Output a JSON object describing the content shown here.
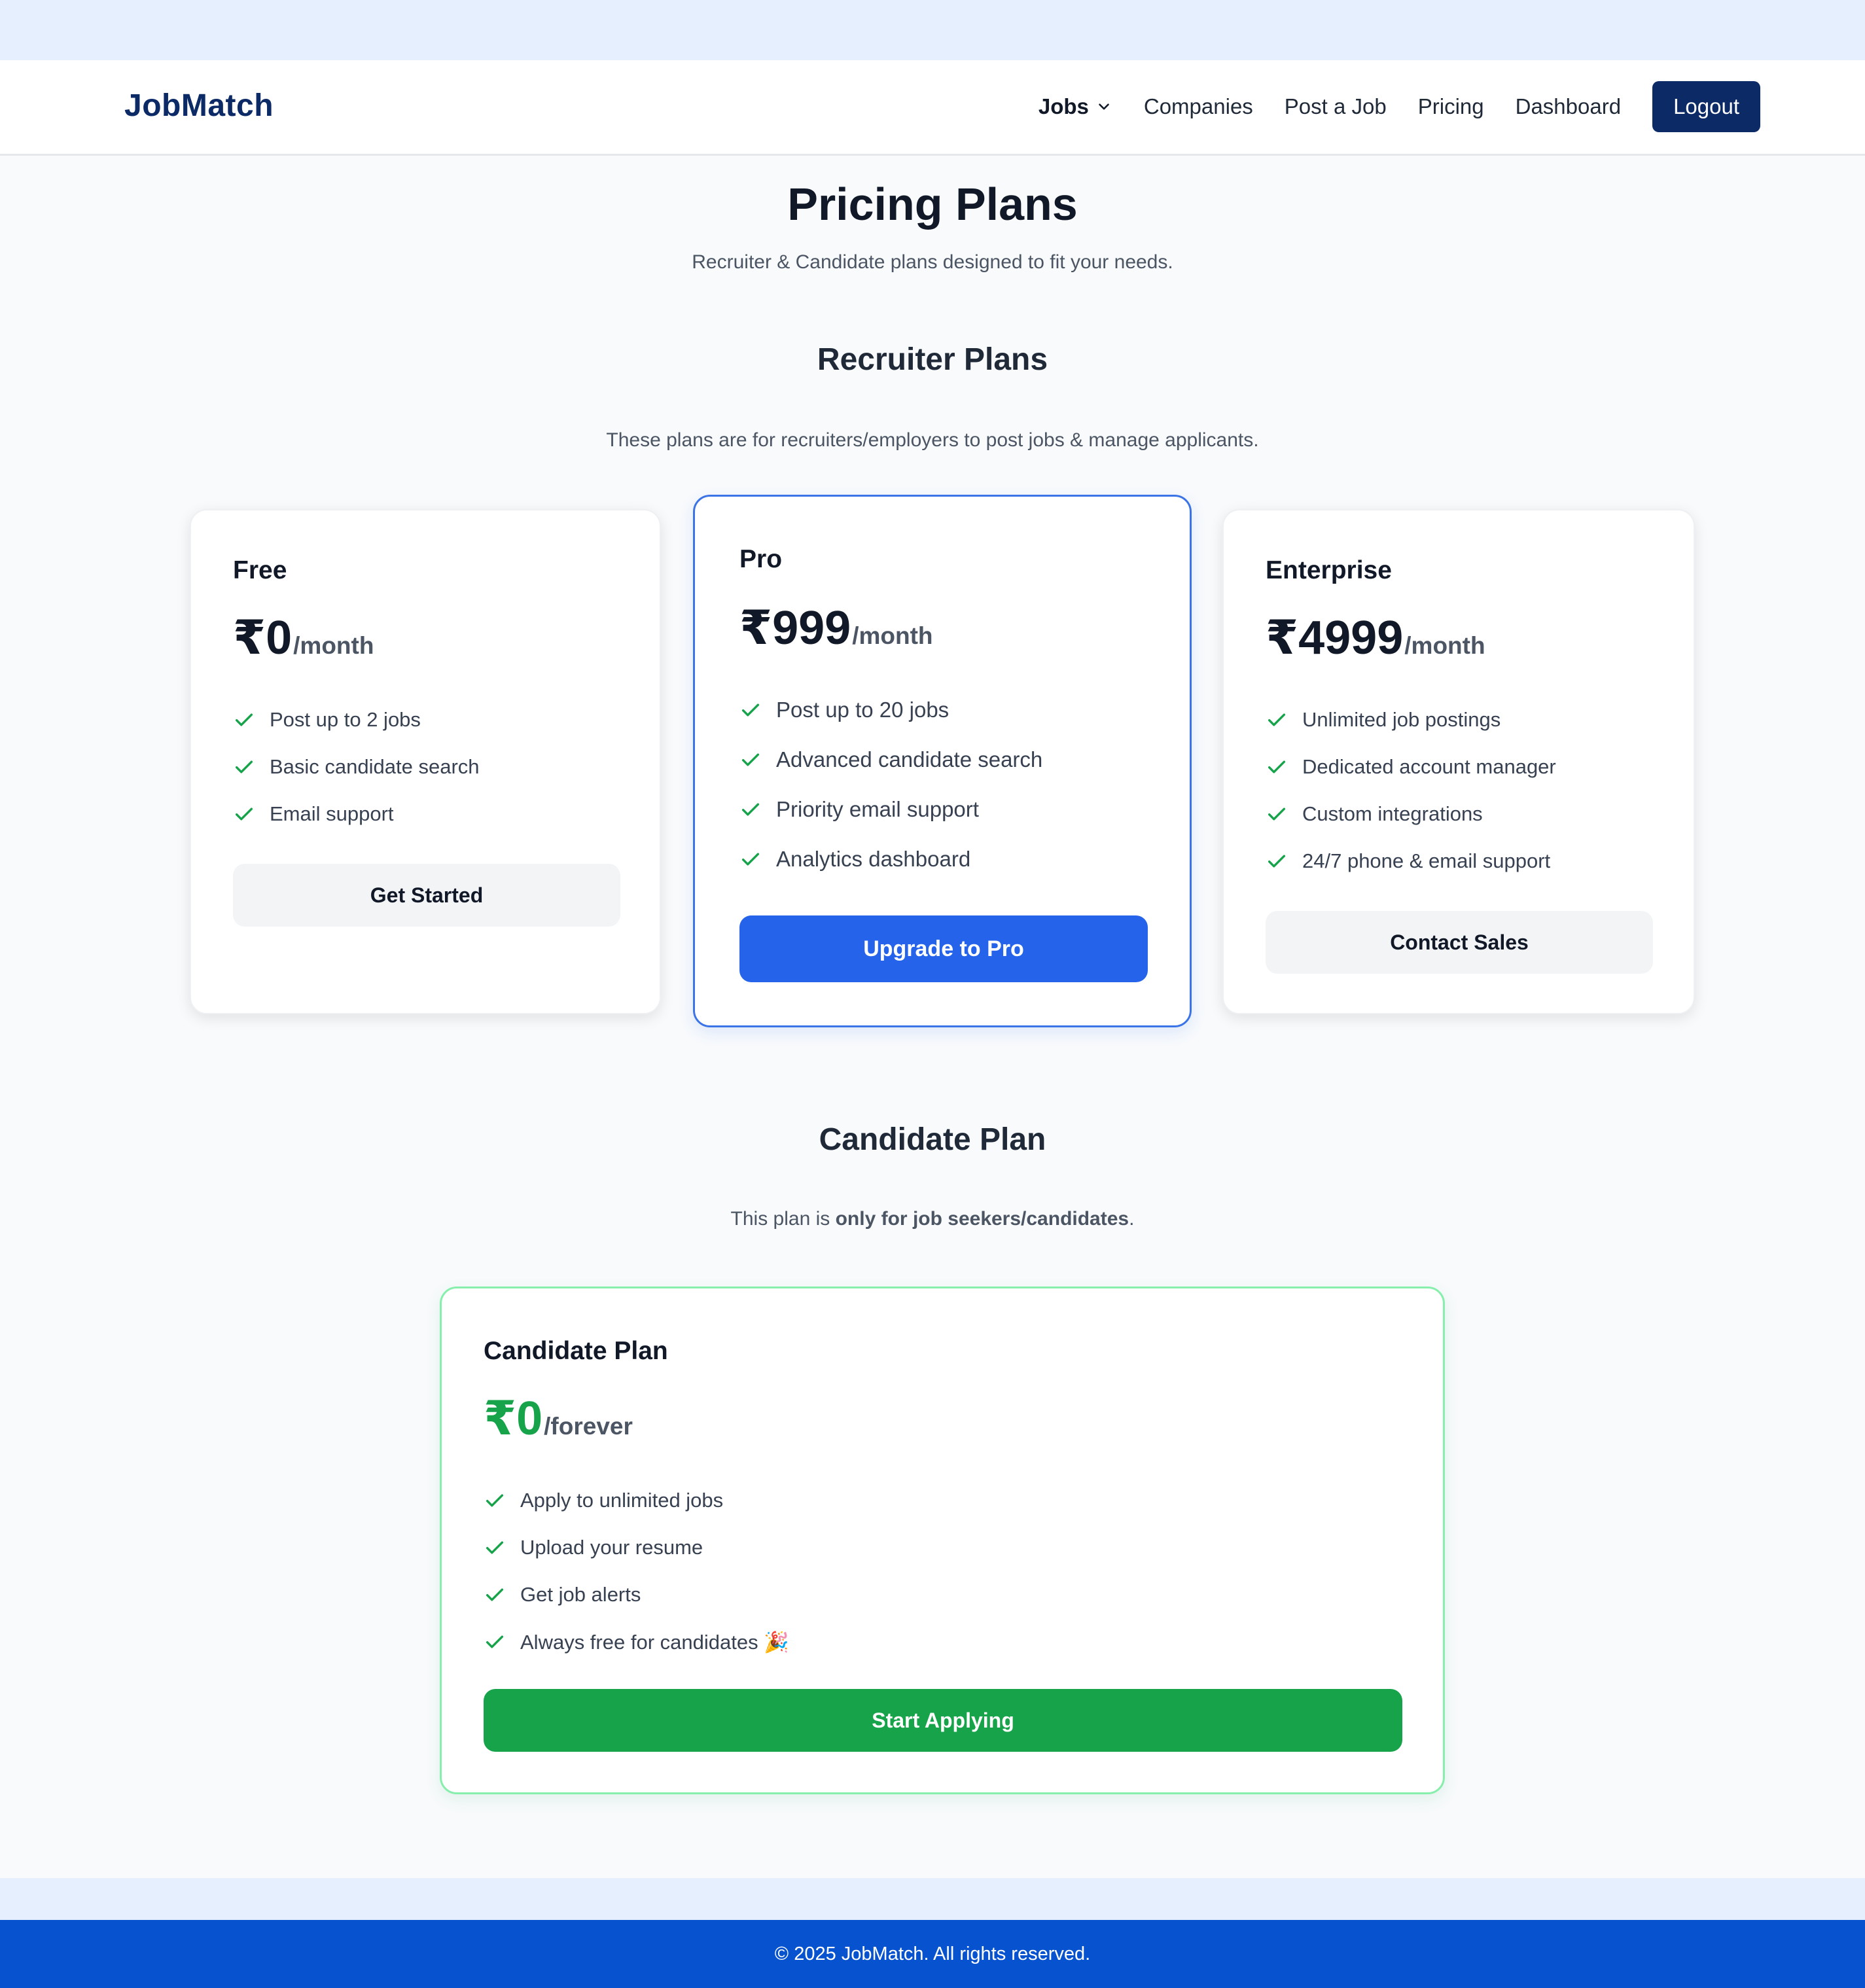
{
  "nav": {
    "logo": "JobMatch",
    "links": {
      "jobs": "Jobs",
      "companies": "Companies",
      "post_job": "Post a Job",
      "pricing": "Pricing",
      "dashboard": "Dashboard"
    },
    "logout": "Logout"
  },
  "header": {
    "title": "Pricing Plans",
    "subtitle": "Recruiter & Candidate plans designed to fit your needs."
  },
  "recruiter": {
    "title": "Recruiter Plans",
    "description": "These plans are for recruiters/employers to post jobs & manage applicants.",
    "plans": [
      {
        "name": "Free",
        "price": "₹0",
        "period": "/month",
        "features": [
          "Post up to 2 jobs",
          "Basic candidate search",
          "Email support"
        ],
        "cta": "Get Started"
      },
      {
        "name": "Pro",
        "price": "₹999",
        "period": "/month",
        "features": [
          "Post up to 20 jobs",
          "Advanced candidate search",
          "Priority email support",
          "Analytics dashboard"
        ],
        "cta": "Upgrade to Pro"
      },
      {
        "name": "Enterprise",
        "price": "₹4999",
        "period": "/month",
        "features": [
          "Unlimited job postings",
          "Dedicated account manager",
          "Custom integrations",
          "24/7 phone & email support"
        ],
        "cta": "Contact Sales"
      }
    ]
  },
  "candidate": {
    "title": "Candidate Plan",
    "description_prefix": "This plan is ",
    "description_bold": "only for job seekers/candidates",
    "description_suffix": ".",
    "plan": {
      "name": "Candidate Plan",
      "price": "₹0",
      "period": "/forever",
      "features": [
        "Apply to unlimited jobs",
        "Upload your resume",
        "Get job alerts",
        "Always free for candidates 🎉"
      ],
      "cta": "Start Applying"
    }
  },
  "footer": {
    "text": "© 2025 JobMatch. All rights reserved."
  },
  "colors": {
    "brand_navy": "#0b2a66",
    "primary_blue": "#2563eb",
    "success_green": "#16a34a",
    "footer_blue": "#0753cf"
  }
}
